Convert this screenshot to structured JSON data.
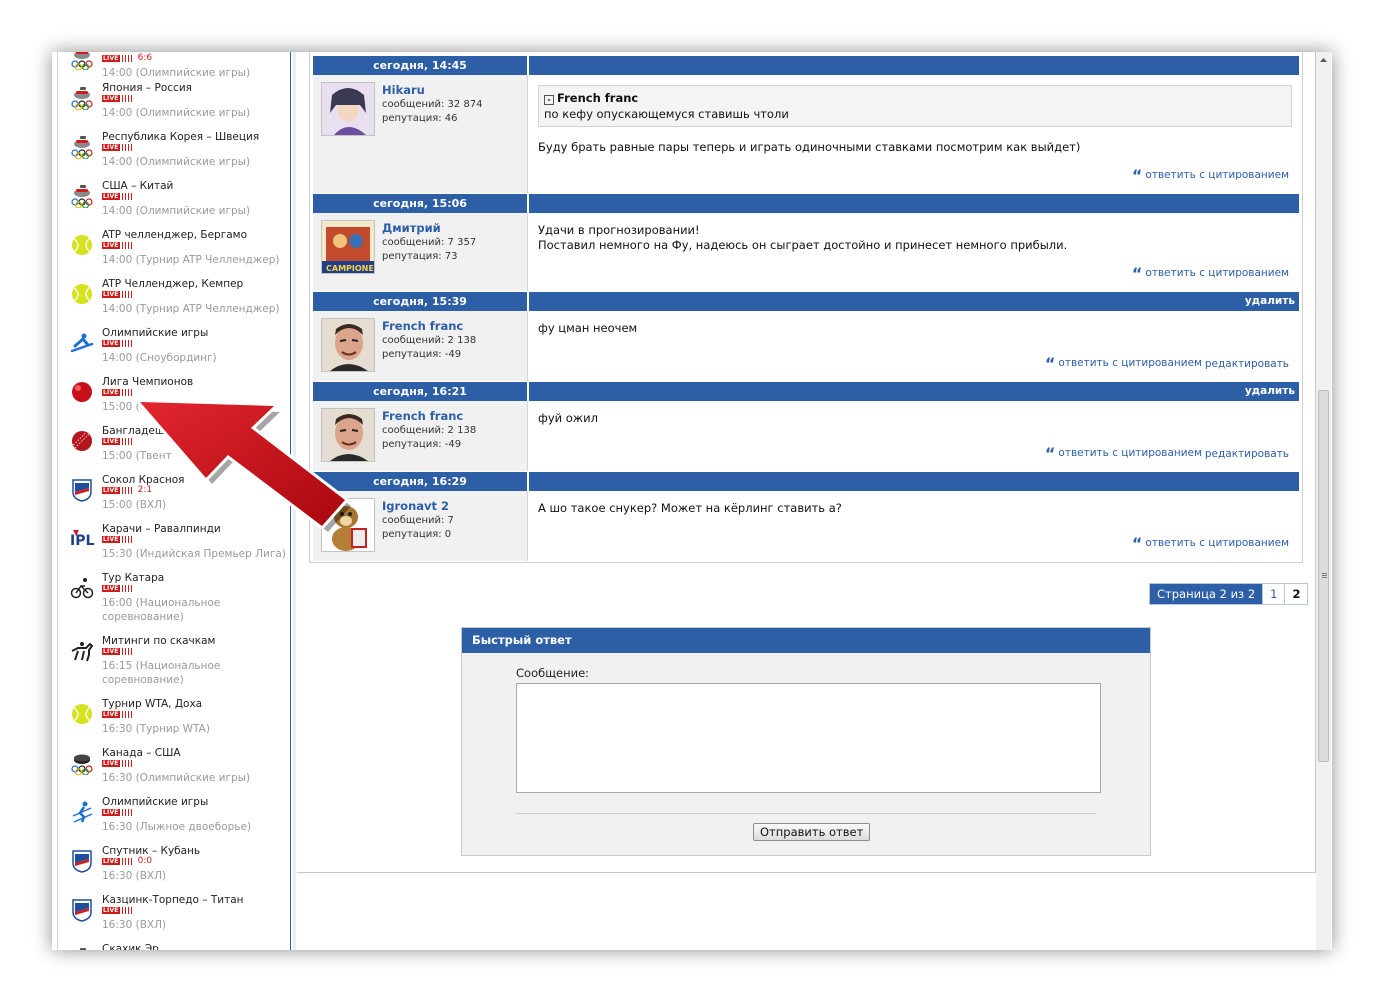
{
  "sidebar": {
    "matches": [
      {
        "title": "",
        "live": "LIVE",
        "score": "6:6",
        "time": "14:00 (Олимпийские игры)",
        "icon": "olympic-curling-icon"
      },
      {
        "title": "Япония – Россия",
        "live": "LIVE",
        "score": "",
        "time": "14:00 (Олимпийские игры)",
        "icon": "olympic-curling-icon"
      },
      {
        "title": "Республика Корея – Швеция",
        "live": "LIVE",
        "score": "",
        "time": "14:00 (Олимпийские игры)",
        "icon": "olympic-curling-icon"
      },
      {
        "title": "США – Китай",
        "live": "LIVE",
        "score": "",
        "time": "14:00 (Олимпийские игры)",
        "icon": "olympic-curling-icon"
      },
      {
        "title": "ATP челленджер, Бергамо",
        "live": "LIVE",
        "score": "",
        "time": "14:00 (Турнир ATP Челленджер)",
        "icon": "tennis-ball-icon"
      },
      {
        "title": "ATP Челленджер, Кемпер",
        "live": "LIVE",
        "score": "",
        "time": "14:00 (Турнир ATP Челленджер)",
        "icon": "tennis-ball-icon"
      },
      {
        "title": "Олимпийские игры",
        "live": "LIVE",
        "score": "",
        "time": "14:00 (Сноубординг)",
        "icon": "snowboard-icon"
      },
      {
        "title": "Лига Чемпионов",
        "live": "LIVE",
        "score": "",
        "time": "15:00 (С",
        "icon": "red-ball-icon"
      },
      {
        "title": "Бангладеш",
        "live": "LIVE",
        "score": "",
        "time": "15:00 (Твент",
        "icon": "cricket-ball-icon"
      },
      {
        "title": "Сокол Красноя",
        "live": "LIVE",
        "score": "2:1",
        "time": "15:00 (ВХЛ)",
        "icon": "vhl-shield-icon"
      },
      {
        "title": "Карачи – Равалпинди",
        "live": "LIVE",
        "score": "",
        "time": "15:30 (Индийская Премьер Лига)",
        "icon": "ipl-logo-icon"
      },
      {
        "title": "Тур Катара",
        "live": "LIVE",
        "score": "",
        "time": "16:00 (Национальное",
        "time2": "соревнование)",
        "icon": "cycling-icon"
      },
      {
        "title": "Митинги по скачкам",
        "live": "LIVE",
        "score": "",
        "time": "16:15 (Национальное",
        "time2": "соревнование)",
        "icon": "horse-racing-icon"
      },
      {
        "title": "Турнир WTA, Доха",
        "live": "LIVE",
        "score": "",
        "time": "16:30 (Турнир WTA)",
        "icon": "tennis-ball-icon"
      },
      {
        "title": "Канада – США",
        "live": "LIVE",
        "score": "",
        "time": "16:30 (Олимпийские игры)",
        "icon": "olympic-hockey-icon"
      },
      {
        "title": "Олимпийские игры",
        "live": "LIVE",
        "score": "",
        "time": "16:30 (Лыжное двоеборье)",
        "icon": "skiing-icon"
      },
      {
        "title": "Спутник – Кубань",
        "live": "LIVE",
        "score": "0:0",
        "time": "16:30 (ВХЛ)",
        "icon": "vhl-shield-icon"
      },
      {
        "title": "Казцинк-Торпедо – Титан",
        "live": "LIVE",
        "score": "",
        "time": "16:30 (ВХЛ)",
        "icon": "vhl-shield-icon"
      },
      {
        "title": "Скахик Эр",
        "live": "",
        "score": "",
        "time": "",
        "icon": "olympic-curling-icon"
      }
    ]
  },
  "posts": [
    {
      "date": "сегодня, 14:45",
      "delete": "",
      "user": "Hikaru",
      "msgs": "сообщений: 32 874",
      "rep": "репутация: 46",
      "quote_author": "French franc",
      "quote_text": "по кефу опускающемуся ставишь чтоли",
      "lines": [
        "Буду брать равные пары теперь и играть одиночными ставками посмотрим как выйдет)"
      ],
      "reply": "ответить с цитированием",
      "edit": ""
    },
    {
      "date": "сегодня, 15:06",
      "delete": "",
      "user": "Дмитрий",
      "msgs": "сообщений: 7 357",
      "rep": "репутация: 73",
      "quote_author": "",
      "quote_text": "",
      "lines": [
        "Удачи в прогнозировании!",
        "Поставил немного на Фу, надеюсь он сыграет достойно и принесет немного прибыли."
      ],
      "reply": "ответить с цитированием",
      "edit": ""
    },
    {
      "date": "сегодня, 15:39",
      "delete": "удалить",
      "user": "French franc",
      "msgs": "сообщений: 2 138",
      "rep": "репутация: -49",
      "quote_author": "",
      "quote_text": "",
      "lines": [
        "фу цман неочем"
      ],
      "reply": "ответить с цитированием",
      "edit": "редактировать"
    },
    {
      "date": "сегодня, 16:21",
      "delete": "удалить",
      "user": "French franc",
      "msgs": "сообщений: 2 138",
      "rep": "репутация: -49",
      "quote_author": "",
      "quote_text": "",
      "lines": [
        "фуй ожил"
      ],
      "reply": "ответить с цитированием",
      "edit": "редактировать"
    },
    {
      "date": "сегодня, 16:29",
      "delete": "",
      "user": "Igronavt 2",
      "msgs": "сообщений: 7",
      "rep": "репутация: 0",
      "quote_author": "",
      "quote_text": "",
      "lines": [
        "А шо такое снукер? Может на кёрлинг ставить а?"
      ],
      "reply": "ответить с цитированием",
      "edit": ""
    }
  ],
  "pager": {
    "label": "Страница 2 из 2",
    "pages": [
      "1",
      "2"
    ],
    "current": "2"
  },
  "quick_reply": {
    "title": "Быстрый ответ",
    "label": "Сообщение:",
    "value": "",
    "submit": "Отправить ответ"
  },
  "colors": {
    "header_blue": "#2c5fa5",
    "live_red": "#d21b1b",
    "arrow_red": "#c8101a"
  }
}
